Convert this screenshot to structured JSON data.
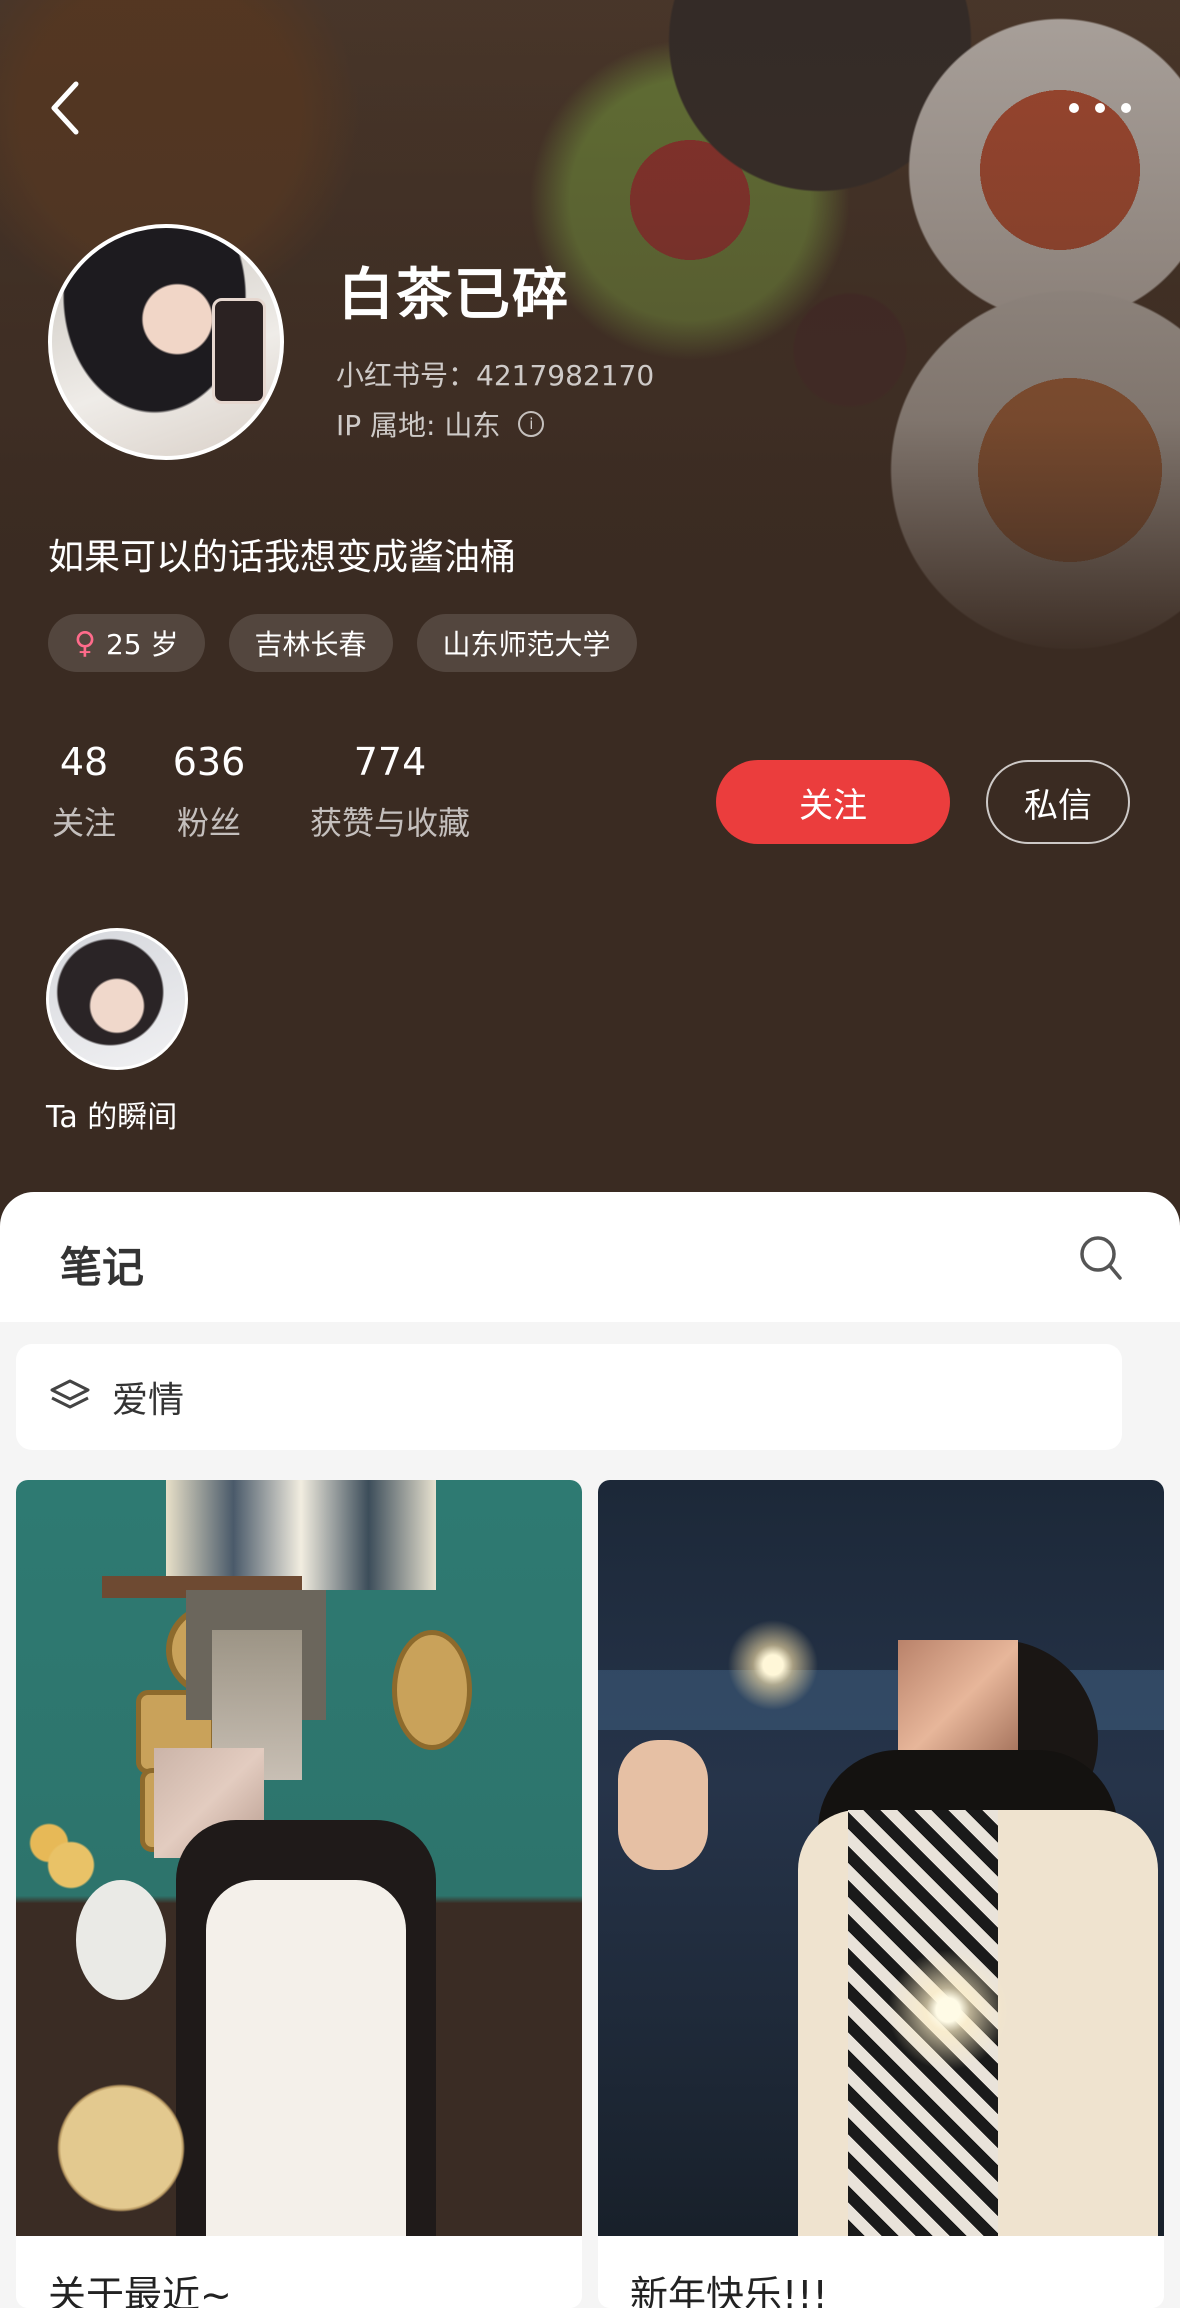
{
  "profile": {
    "name": "白茶已碎",
    "xhs_id": "小红书号：4217982170",
    "ip_location": "IP 属地: 山东",
    "bio": "如果可以的话我想变成酱油桶",
    "tags": [
      "25 岁",
      "吉林长春",
      "山东师范大学"
    ]
  },
  "stats": [
    {
      "value": "48",
      "label": "关注"
    },
    {
      "value": "636",
      "label": "粉丝"
    },
    {
      "value": "774",
      "label": "获赞与收藏"
    }
  ],
  "actions": {
    "follow": "关注",
    "message": "私信"
  },
  "moments": {
    "label": "Ta 的瞬间"
  },
  "notes": {
    "title": "笔记",
    "category": "爱情",
    "cards": [
      {
        "title": "关于最近~"
      },
      {
        "title": "新年快乐!!!"
      }
    ]
  },
  "colors": {
    "accent": "#eb3d3d",
    "header_bg": "#3a2b22"
  }
}
